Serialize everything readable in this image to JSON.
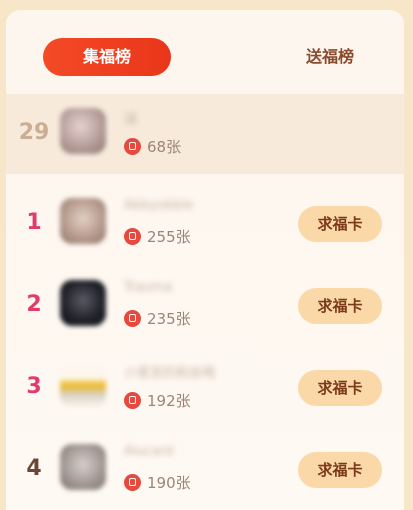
{
  "tabs": [
    {
      "label": "集福榜",
      "active": true
    },
    {
      "label": "送福榜",
      "active": false
    }
  ],
  "self_row": {
    "rank": "29",
    "name": "涵",
    "count": "68张"
  },
  "rows": [
    {
      "rank": "1",
      "name": "Abbyobble",
      "count": "255张",
      "button": "求福卡"
    },
    {
      "rank": "2",
      "name": "Trauma",
      "count": "235张",
      "button": "求福卡"
    },
    {
      "rank": "3",
      "name": "小是苦的和会喝",
      "count": "192张",
      "button": "求福卡"
    },
    {
      "rank": "4",
      "name": "Alucard",
      "count": "190张",
      "button": "求福卡"
    }
  ],
  "colors": {
    "active_tab": "#f0401f",
    "rank_top3": "#e23a6d",
    "rank_other": "#6b4738",
    "button_bg": "#fbd8a8",
    "button_text": "#7b3a1a"
  },
  "icons": [
    "fu-card-icon"
  ]
}
